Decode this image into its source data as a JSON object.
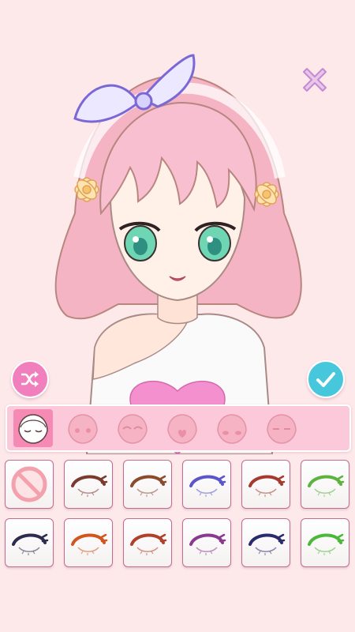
{
  "ui": {
    "close_icon": "close-x-icon",
    "shuffle_icon": "shuffle-icon",
    "confirm_icon": "checkmark-icon"
  },
  "colors": {
    "background": "#fde8ea",
    "close": "#e6b8e6",
    "shuffle": "#f27fbd",
    "confirm": "#46c7dc",
    "category_bar": "#fbc9da",
    "category_active": "#f58ab4"
  },
  "categories": [
    {
      "id": "eyes",
      "icon": "face-eyes-icon",
      "active": true
    },
    {
      "id": "blush",
      "icon": "face-blush-icon",
      "active": false
    },
    {
      "id": "eyebrows",
      "icon": "face-eyebrows-icon",
      "active": false
    },
    {
      "id": "mouth",
      "icon": "face-mouth-icon",
      "active": false
    },
    {
      "id": "cheeks",
      "icon": "face-cheeks-icon",
      "active": false
    },
    {
      "id": "expression",
      "icon": "face-expression-icon",
      "active": false
    }
  ],
  "options": [
    {
      "type": "none",
      "icon": "no-selection-icon"
    },
    {
      "type": "eye",
      "color": "#7a3b2e"
    },
    {
      "type": "eye",
      "color": "#8a4a2e"
    },
    {
      "type": "eye",
      "color": "#5a55c8"
    },
    {
      "type": "eye",
      "color": "#a53a2e"
    },
    {
      "type": "eye",
      "color": "#5cb33e"
    },
    {
      "type": "eye",
      "color": "#2c2c4e"
    },
    {
      "type": "eye",
      "color": "#d0561e"
    },
    {
      "type": "eye",
      "color": "#b0402c"
    },
    {
      "type": "eye",
      "color": "#8a3a8e"
    },
    {
      "type": "eye",
      "color": "#2a2a6e"
    },
    {
      "type": "eye",
      "color": "#4cb83a"
    }
  ]
}
